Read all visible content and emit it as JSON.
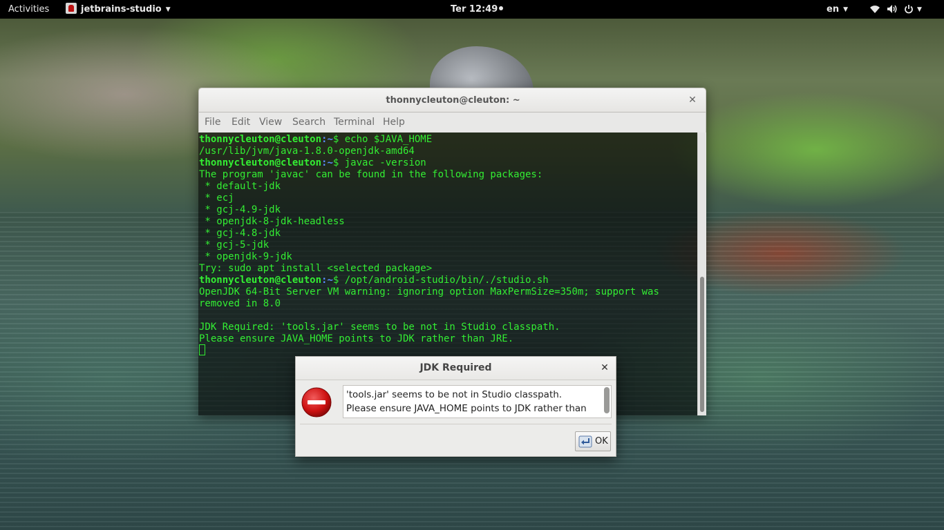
{
  "topbar": {
    "activities": "Activities",
    "app_name": "jetbrains-studio",
    "clock": "Ter 12:49",
    "language": "en"
  },
  "terminal": {
    "title": "thonnycleuton@cleuton: ~",
    "menu": [
      "File",
      "Edit",
      "View",
      "Search",
      "Terminal",
      "Help"
    ],
    "prompt_user": "thonnycleuton@cleuton",
    "prompt_path": ":~",
    "lines": [
      {
        "type": "prompt",
        "command": "$ echo $JAVA_HOME"
      },
      {
        "type": "output",
        "text": "/usr/lib/jvm/java-1.8.0-openjdk-amd64"
      },
      {
        "type": "prompt",
        "command": "$ javac -version"
      },
      {
        "type": "output",
        "text": "The program 'javac' can be found in the following packages:"
      },
      {
        "type": "output",
        "text": " * default-jdk"
      },
      {
        "type": "output",
        "text": " * ecj"
      },
      {
        "type": "output",
        "text": " * gcj-4.9-jdk"
      },
      {
        "type": "output",
        "text": " * openjdk-8-jdk-headless"
      },
      {
        "type": "output",
        "text": " * gcj-4.8-jdk"
      },
      {
        "type": "output",
        "text": " * gcj-5-jdk"
      },
      {
        "type": "output",
        "text": " * openjdk-9-jdk"
      },
      {
        "type": "output",
        "text": "Try: sudo apt install <selected package>"
      },
      {
        "type": "prompt",
        "command": "$ /opt/android-studio/bin/./studio.sh"
      },
      {
        "type": "output",
        "text": "OpenJDK 64-Bit Server VM warning: ignoring option MaxPermSize=350m; support was"
      },
      {
        "type": "output",
        "text": "removed in 8.0"
      },
      {
        "type": "output",
        "text": ""
      },
      {
        "type": "output",
        "text": "JDK Required: 'tools.jar' seems to be not in Studio classpath."
      },
      {
        "type": "output",
        "text": "Please ensure JAVA_HOME points to JDK rather than JRE."
      }
    ]
  },
  "dialog": {
    "title": "JDK Required",
    "message_line1": "'tools.jar' seems to be not in Studio classpath.",
    "message_line2": "Please ensure JAVA_HOME points to JDK rather than",
    "ok_label": "OK"
  },
  "colors": {
    "terminal_text": "#33ee33",
    "topbar_bg": "#000000",
    "error_red": "#cc1111"
  }
}
